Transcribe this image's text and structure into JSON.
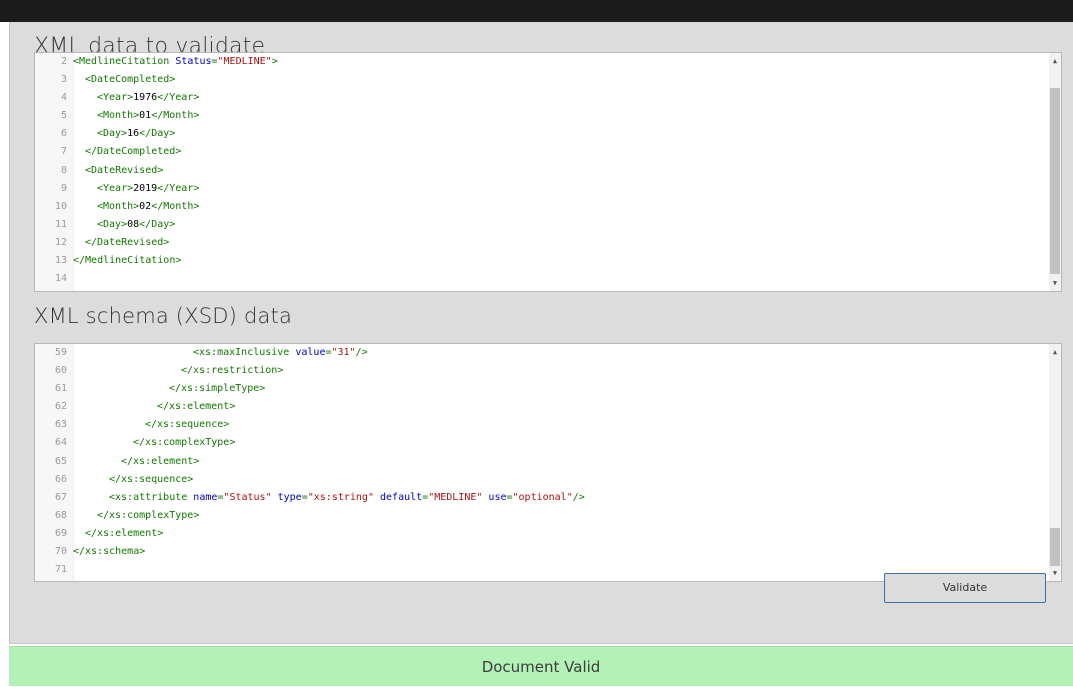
{
  "xml_section": {
    "heading": "XML data to validate",
    "lines": [
      {
        "n": "2",
        "indent": 0,
        "parts": [
          [
            "tag",
            "<MedlineCitation "
          ],
          [
            "attr",
            "Status"
          ],
          [
            "tag",
            "="
          ],
          [
            "str",
            "\"MEDLINE\""
          ],
          [
            "tag",
            ">"
          ]
        ]
      },
      {
        "n": "3",
        "indent": 1,
        "parts": [
          [
            "tag",
            "<DateCompleted>"
          ]
        ]
      },
      {
        "n": "4",
        "indent": 2,
        "parts": [
          [
            "tag",
            "<Year>"
          ],
          [
            "txt",
            "1976"
          ],
          [
            "tag",
            "</Year>"
          ]
        ]
      },
      {
        "n": "5",
        "indent": 2,
        "parts": [
          [
            "tag",
            "<Month>"
          ],
          [
            "txt",
            "01"
          ],
          [
            "tag",
            "</Month>"
          ]
        ]
      },
      {
        "n": "6",
        "indent": 2,
        "parts": [
          [
            "tag",
            "<Day>"
          ],
          [
            "txt",
            "16"
          ],
          [
            "tag",
            "</Day>"
          ]
        ]
      },
      {
        "n": "7",
        "indent": 1,
        "parts": [
          [
            "tag",
            "</DateCompleted>"
          ]
        ]
      },
      {
        "n": "8",
        "indent": 1,
        "parts": [
          [
            "tag",
            "<DateRevised>"
          ]
        ]
      },
      {
        "n": "9",
        "indent": 2,
        "parts": [
          [
            "tag",
            "<Year>"
          ],
          [
            "txt",
            "2019"
          ],
          [
            "tag",
            "</Year>"
          ]
        ]
      },
      {
        "n": "10",
        "indent": 2,
        "parts": [
          [
            "tag",
            "<Month>"
          ],
          [
            "txt",
            "02"
          ],
          [
            "tag",
            "</Month>"
          ]
        ]
      },
      {
        "n": "11",
        "indent": 2,
        "parts": [
          [
            "tag",
            "<Day>"
          ],
          [
            "txt",
            "08"
          ],
          [
            "tag",
            "</Day>"
          ]
        ]
      },
      {
        "n": "12",
        "indent": 1,
        "parts": [
          [
            "tag",
            "</DateRevised>"
          ]
        ]
      },
      {
        "n": "13",
        "indent": 0,
        "parts": [
          [
            "tag",
            "</MedlineCitation>"
          ]
        ]
      },
      {
        "n": "14",
        "indent": 0,
        "parts": []
      }
    ]
  },
  "xsd_section": {
    "heading": "XML schema (XSD) data",
    "lines": [
      {
        "n": "59",
        "indent": 10,
        "parts": [
          [
            "tag",
            "<xs:maxInclusive "
          ],
          [
            "attr",
            "value"
          ],
          [
            "tag",
            "="
          ],
          [
            "str",
            "\"31\""
          ],
          [
            "tag",
            "/>"
          ]
        ]
      },
      {
        "n": "60",
        "indent": 9,
        "parts": [
          [
            "tag",
            "</xs:restriction>"
          ]
        ]
      },
      {
        "n": "61",
        "indent": 8,
        "parts": [
          [
            "tag",
            "</xs:simpleType>"
          ]
        ]
      },
      {
        "n": "62",
        "indent": 7,
        "parts": [
          [
            "tag",
            "</xs:element>"
          ]
        ]
      },
      {
        "n": "63",
        "indent": 6,
        "parts": [
          [
            "tag",
            "</xs:sequence>"
          ]
        ]
      },
      {
        "n": "64",
        "indent": 5,
        "parts": [
          [
            "tag",
            "</xs:complexType>"
          ]
        ]
      },
      {
        "n": "65",
        "indent": 4,
        "parts": [
          [
            "tag",
            "</xs:element>"
          ]
        ]
      },
      {
        "n": "66",
        "indent": 3,
        "parts": [
          [
            "tag",
            "</xs:sequence>"
          ]
        ]
      },
      {
        "n": "67",
        "indent": 3,
        "parts": [
          [
            "tag",
            "<xs:attribute "
          ],
          [
            "attr",
            "name"
          ],
          [
            "tag",
            "="
          ],
          [
            "str",
            "\"Status\""
          ],
          [
            "tag",
            " "
          ],
          [
            "attr",
            "type"
          ],
          [
            "tag",
            "="
          ],
          [
            "str",
            "\"xs:string\""
          ],
          [
            "tag",
            " "
          ],
          [
            "attr",
            "default"
          ],
          [
            "tag",
            "="
          ],
          [
            "str",
            "\"MEDLINE\""
          ],
          [
            "tag",
            " "
          ],
          [
            "attr",
            "use"
          ],
          [
            "tag",
            "="
          ],
          [
            "str",
            "\"optional\""
          ],
          [
            "tag",
            "/>"
          ]
        ]
      },
      {
        "n": "68",
        "indent": 2,
        "parts": [
          [
            "tag",
            "</xs:complexType>"
          ]
        ]
      },
      {
        "n": "69",
        "indent": 1,
        "parts": [
          [
            "tag",
            "</xs:element>"
          ]
        ]
      },
      {
        "n": "70",
        "indent": 0,
        "parts": [
          [
            "tag",
            "</xs:schema>"
          ]
        ]
      },
      {
        "n": "71",
        "indent": 0,
        "parts": []
      }
    ]
  },
  "validate_button": {
    "label": "Validate"
  },
  "status": {
    "text": "Document Valid"
  },
  "colors": {
    "tag": "#117700",
    "attribute": "#0000cc",
    "string": "#aa1111",
    "status_bg": "#b4f1b6"
  }
}
